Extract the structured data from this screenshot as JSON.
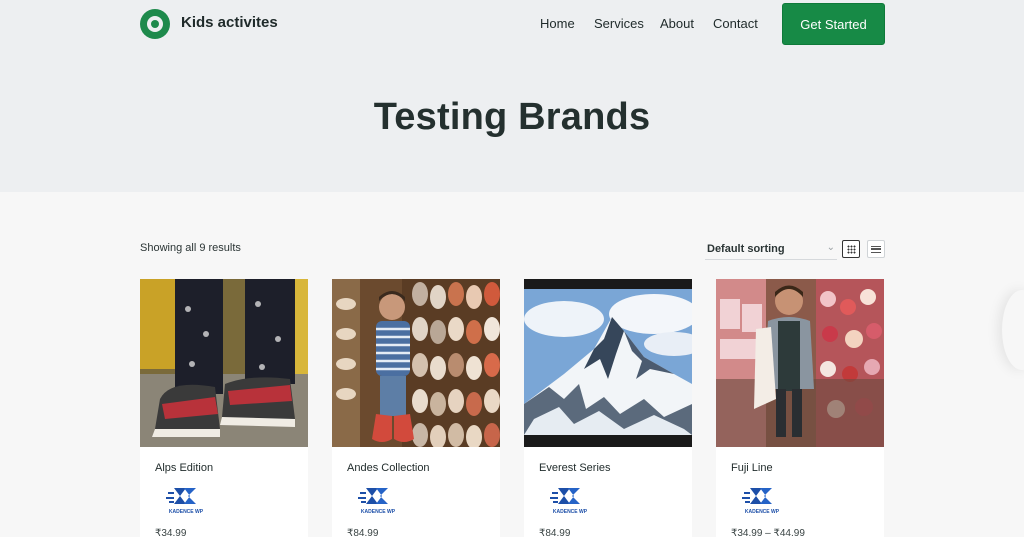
{
  "header": {
    "site_title": "Kids activites",
    "nav": [
      "Home",
      "Services",
      "About",
      "Contact"
    ],
    "cta_label": "Get Started",
    "brand_color": "#178a46"
  },
  "hero": {
    "title": "Testing Brands"
  },
  "shop": {
    "result_count": "Showing all 9 results",
    "sorting": "Default sorting",
    "view_modes": [
      "grid-view",
      "list-view"
    ],
    "active_view": "grid-view"
  },
  "products": [
    {
      "name": "Alps Edition",
      "price": "₹34.99",
      "image": "child-sneakers"
    },
    {
      "name": "Andes Collection",
      "price": "₹84.99",
      "image": "shoe-shop-child"
    },
    {
      "name": "Everest Series",
      "price": "₹84.99",
      "image": "snowy-mountain"
    },
    {
      "name": "Fuji Line",
      "price": "₹34.99 – ₹44.99",
      "image": "child-in-store"
    }
  ],
  "brand_logo_text": "KADENCE WP"
}
